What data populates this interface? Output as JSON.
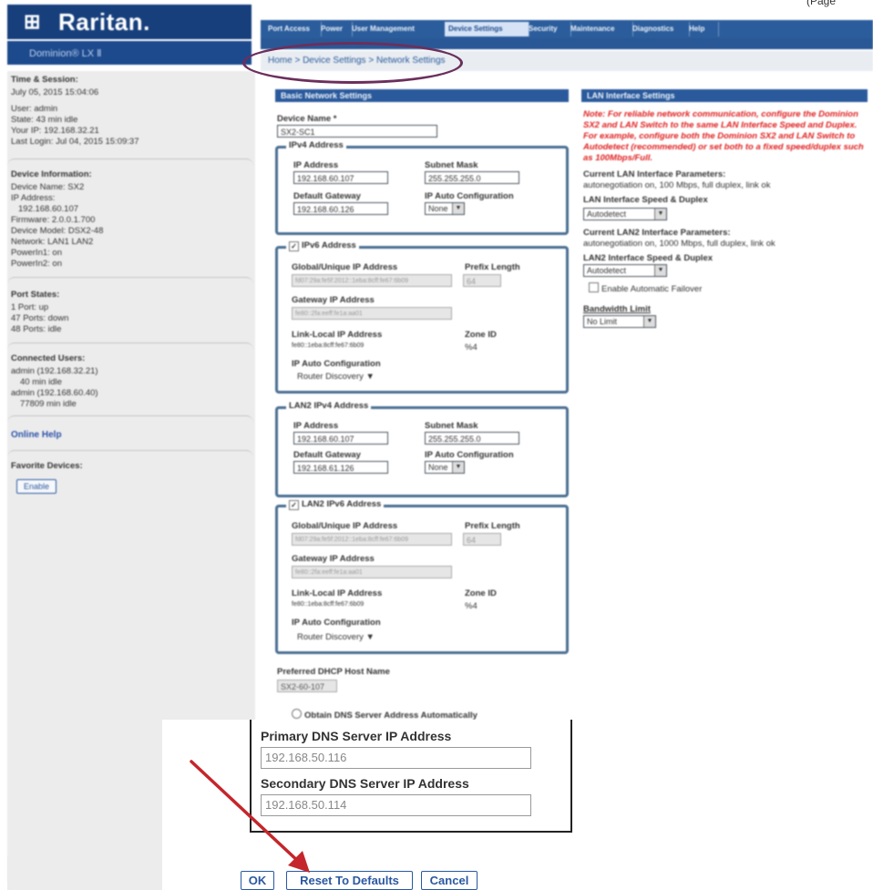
{
  "corner_label": "(Page",
  "brand": {
    "mark": "⊞",
    "name": "Raritan."
  },
  "device_bar": {
    "label": "Dominion® LX Ⅱ"
  },
  "tabs": [
    "Port Access",
    "Power",
    "User Management",
    "Device Settings",
    "Security",
    "Maintenance",
    "Diagnostics",
    "Help"
  ],
  "breadcrumb": "Home > Device Settings > Network Settings",
  "sidebar": {
    "time_session": {
      "heading": "Time & Session:",
      "lines": [
        "July 05, 2015 15:04:06",
        "",
        "User: admin",
        "State: 43 min idle",
        "Your IP: 192.168.32.21",
        "Last Login: Jul 04, 2015 15:09:37"
      ]
    },
    "device_info": {
      "heading": "Device Information:",
      "lines": [
        "Device Name: SX2",
        "IP Address:",
        "192.168.60.107",
        "Firmware: 2.0.0.1.700",
        "Device Model: DSX2-48",
        "Network: LAN1 LAN2",
        "PowerIn1: on",
        "PowerIn2: on"
      ]
    },
    "port_states": {
      "heading": "Port States:",
      "lines": [
        "1 Port: up",
        "47 Ports: down",
        "48 Ports: idle"
      ]
    },
    "connected_users": {
      "heading": "Connected Users:",
      "lines": [
        "admin (192.168.32.21)",
        "40 min idle",
        "admin (192.168.60.40)",
        "77809 min idle"
      ]
    },
    "online_help": "Online Help",
    "favorite_devices": "Favorite Devices:",
    "enable_button": "Enable"
  },
  "basic": {
    "header": "Basic Network Settings",
    "device_name_label": "Device Name *",
    "device_name_value": "SX2-SC1",
    "ipv4": {
      "legend": "IPv4 Address",
      "ip_label": "IP Address",
      "ip_value": "192.168.60.107",
      "mask_label": "Subnet Mask",
      "mask_value": "255.255.255.0",
      "gw_label": "Default Gateway",
      "gw_value": "192.168.60.126",
      "auto_label": "IP Auto Configuration",
      "auto_value": "None"
    },
    "ipv6": {
      "legend": "IPv6 Address",
      "global_label": "Global/Unique IP Address",
      "global_value": "fd07:29a:fe5f:2012::1eba:8cff:fe67:6b09",
      "prefix_label": "Prefix Length",
      "prefix_value": "64",
      "gw_label": "Gateway IP Address",
      "gw_value": "fe80::2fa:eeff:fe1a:aa01",
      "link_label": "Link-Local IP Address",
      "link_value": "fe80::1eba:8cff:fe67:6b09",
      "zone_label": "Zone ID",
      "zone_value": "%4",
      "auto_label": "IP Auto Configuration",
      "auto_value": "Router Discovery"
    },
    "lan2_ipv4": {
      "legend": "LAN2 IPv4 Address",
      "ip_label": "IP Address",
      "ip_value": "192.168.60.107",
      "mask_label": "Subnet Mask",
      "mask_value": "255.255.255.0",
      "gw_label": "Default Gateway",
      "gw_value": "192.168.61.126",
      "auto_label": "IP Auto Configuration",
      "auto_value": "None"
    },
    "lan2_ipv6": {
      "legend": "LAN2 IPv6 Address",
      "global_label": "Global/Unique IP Address",
      "global_value": "fd07:29a:fe5f:2012::1eba:8cff:fe67:6b09",
      "prefix_label": "Prefix Length",
      "prefix_value": "64",
      "gw_label": "Gateway IP Address",
      "gw_value": "fe80::2fa:eeff:fe1a:aa01",
      "link_label": "Link-Local IP Address",
      "link_value": "fe80::1eba:8cff:fe67:6b09",
      "zone_label": "Zone ID",
      "zone_value": "%4",
      "auto_label": "IP Auto Configuration",
      "auto_value": "Router Discovery"
    },
    "dhcp_label": "Preferred DHCP Host Name",
    "dhcp_value": "SX2-60-107",
    "dns_auto_label": "Obtain DNS Server Address Automatically"
  },
  "lan": {
    "header": "LAN Interface Settings",
    "note": "Note: For reliable network communication, configure the Dominion SX2 and LAN Switch to the same LAN Interface Speed and Duplex. For example, configure both the Dominion SX2 and LAN Switch to Autodetect (recommended) or set both to a fixed speed/duplex such as 100Mbps/Full.",
    "current_label": "Current LAN Interface Parameters:",
    "current_value": "autonegotiation on, 100 Mbps, full duplex, link ok",
    "speed_label": "LAN Interface Speed & Duplex",
    "speed_value": "Autodetect",
    "current2_label": "Current LAN2 Interface Parameters:",
    "current2_value": "autonegotiation on, 1000 Mbps, full duplex, link ok",
    "speed2_label": "LAN2 Interface Speed & Duplex",
    "speed2_value": "Autodetect",
    "failover_label": "Enable Automatic Failover",
    "bandwidth_label": "Bandwidth Limit",
    "bandwidth_value": "No Limit"
  },
  "dns": {
    "primary_label": "Primary DNS Server IP Address",
    "primary_value": "192.168.50.116",
    "secondary_label": "Secondary DNS Server IP Address",
    "secondary_value": "192.168.50.114"
  },
  "buttons": {
    "ok": "OK",
    "reset": "Reset To Defaults",
    "cancel": "Cancel"
  },
  "colors": {
    "header_blue": "#2a5a9c",
    "note_red": "#e02020",
    "oval": "#6b2f5c",
    "arrow": "#c4262b"
  }
}
